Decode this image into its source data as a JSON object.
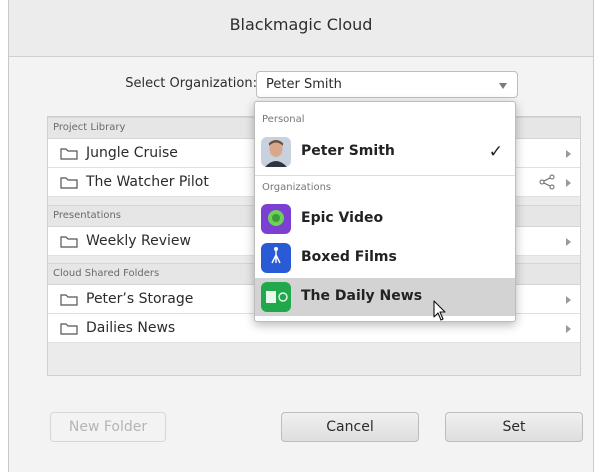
{
  "window": {
    "title": "Blackmagic Cloud"
  },
  "org_picker": {
    "label": "Select Organization:",
    "value": "Peter Smith"
  },
  "library": {
    "sections": [
      {
        "label": "Project Library",
        "items": [
          {
            "label": "Jungle Cruise"
          },
          {
            "label": "The Watcher Pilot"
          }
        ]
      },
      {
        "label": "Presentations",
        "items": [
          {
            "label": "Weekly Review"
          }
        ]
      },
      {
        "label": "Cloud Shared Folders",
        "items": [
          {
            "label": "Peter’s Storage"
          },
          {
            "label": "Dailies News"
          }
        ]
      }
    ]
  },
  "dropdown": {
    "personal_header": "Personal",
    "personal_item": {
      "label": "Peter Smith",
      "icon": "user-avatar-icon",
      "selected": true
    },
    "orgs_header": "Organizations",
    "org_items": [
      {
        "label": "Epic Video",
        "icon": "epic-video-logo",
        "color": "#7b3fd1"
      },
      {
        "label": "Boxed Films",
        "icon": "boxed-films-logo",
        "color": "#2a5bd7"
      },
      {
        "label": "The Daily News",
        "icon": "daily-news-logo",
        "color": "#20a84a"
      }
    ]
  },
  "buttons": {
    "new_folder": "New Folder",
    "cancel": "Cancel",
    "set": "Set"
  }
}
